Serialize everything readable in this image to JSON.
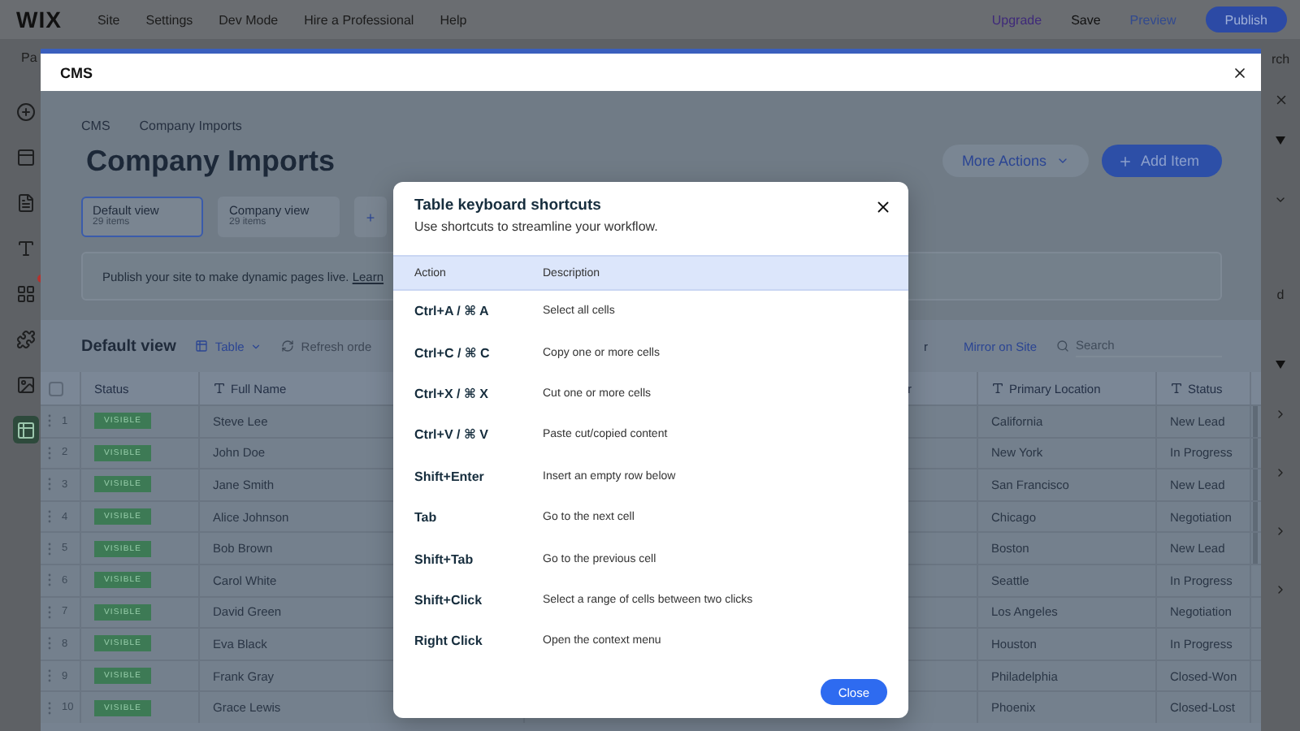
{
  "top_bar": {
    "logo": "WIX",
    "menu": [
      "Site",
      "Settings",
      "Dev Mode",
      "Hire a Professional",
      "Help"
    ],
    "upgrade": "Upgrade",
    "save": "Save",
    "preview": "Preview",
    "publish": "Publish"
  },
  "secondary_bar": {
    "left": "Pa",
    "right": "rch"
  },
  "sidebar": {
    "items": [
      {
        "selected": false,
        "notification": false
      },
      {
        "selected": false,
        "notification": false
      },
      {
        "selected": false,
        "notification": false
      },
      {
        "selected": false,
        "notification": false
      },
      {
        "selected": false,
        "notification": true
      },
      {
        "selected": false,
        "notification": false
      },
      {
        "selected": false,
        "notification": false
      },
      {
        "selected": true,
        "notification": false
      }
    ]
  },
  "right_strip": {
    "label": "d"
  },
  "cms_panel": {
    "title": "CMS",
    "breadcrumb": [
      "CMS",
      "Company Imports"
    ],
    "heading": "Company Imports",
    "more_actions": "More Actions",
    "add_item": "Add Item",
    "views": [
      {
        "name": "Default view",
        "count": "29 items",
        "selected": true
      },
      {
        "name": "Company view",
        "count": "29 items",
        "selected": false
      }
    ],
    "add_view": "+",
    "banner": {
      "text": "Publish your site to make dynamic pages live.",
      "link": "Learn"
    },
    "toolbar": {
      "view_title": "Default view",
      "layout": "Table",
      "refresh": "Refresh orde",
      "fragment": "r",
      "mirror": "Mirror on Site",
      "search_placeholder": "Search"
    },
    "table": {
      "select_all": {
        "checked": false
      },
      "columns": [
        {
          "label": "Status",
          "kind": "plain"
        },
        {
          "label": "Full Name",
          "kind": "text"
        },
        {
          "label": "r",
          "kind": "plain"
        },
        {
          "label": "Primary Location",
          "kind": "text"
        },
        {
          "label": "Status",
          "kind": "text"
        }
      ],
      "rows": [
        {
          "number": "1",
          "tag": "VISIBLE",
          "name": "Steve Lee",
          "location": "California",
          "stage": "New Lead"
        },
        {
          "number": "2",
          "tag": "VISIBLE",
          "name": "John Doe",
          "location": "New York",
          "stage": "In Progress"
        },
        {
          "number": "3",
          "tag": "VISIBLE",
          "name": "Jane Smith",
          "location": "San Francisco",
          "stage": "New Lead"
        },
        {
          "number": "4",
          "tag": "VISIBLE",
          "name": "Alice Johnson",
          "location": "Chicago",
          "stage": "Negotiation"
        },
        {
          "number": "5",
          "tag": "VISIBLE",
          "name": "Bob Brown",
          "location": "Boston",
          "stage": "New Lead"
        },
        {
          "number": "6",
          "tag": "VISIBLE",
          "name": "Carol White",
          "location": "Seattle",
          "stage": "In Progress"
        },
        {
          "number": "7",
          "tag": "VISIBLE",
          "name": "David Green",
          "location": "Los Angeles",
          "stage": "Negotiation"
        },
        {
          "number": "8",
          "tag": "VISIBLE",
          "name": "Eva Black",
          "location": "Houston",
          "stage": "In Progress"
        },
        {
          "number": "9",
          "tag": "VISIBLE",
          "name": "Frank Gray",
          "location": "Philadelphia",
          "stage": "Closed-Won"
        },
        {
          "number": "10",
          "tag": "VISIBLE",
          "name": "Grace Lewis",
          "location": "Phoenix",
          "stage": "Closed-Lost"
        }
      ]
    }
  },
  "shortcuts_dialog": {
    "title": "Table keyboard shortcuts",
    "subtitle": "Use shortcuts to streamline your workflow.",
    "columns": [
      "Action",
      "Description"
    ],
    "rows": [
      {
        "keys": "Ctrl+A / ⌘ A",
        "description": "Select all cells"
      },
      {
        "keys": "Ctrl+C / ⌘ C",
        "description": "Copy one or more cells"
      },
      {
        "keys": "Ctrl+X / ⌘ X",
        "description": "Cut one or more cells"
      },
      {
        "keys": "Ctrl+V / ⌘ V",
        "description": "Paste cut/copied content"
      },
      {
        "keys": "Shift+Enter",
        "description": "Insert an empty row below"
      },
      {
        "keys": "Tab",
        "description": "Go to the next cell"
      },
      {
        "keys": "Shift+Tab",
        "description": "Go to the previous cell"
      },
      {
        "keys": "Shift+Click",
        "description": "Select a range of cells between two clicks"
      },
      {
        "keys": "Right Click",
        "description": "Open the context menu"
      }
    ],
    "close_button": "Close"
  }
}
